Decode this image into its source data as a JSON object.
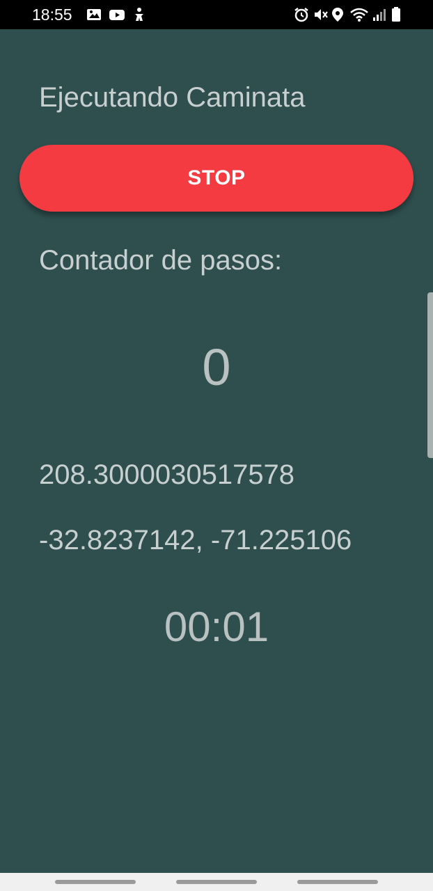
{
  "status_bar": {
    "time": "18:55",
    "left_icons": [
      "image-icon",
      "youtube-icon",
      "accessibility-icon"
    ],
    "right_icons": [
      "alarm-icon",
      "mute-icon",
      "location-icon",
      "wifi-icon",
      "signal-icon",
      "battery-icon"
    ]
  },
  "screen": {
    "title": "Ejecutando Caminata",
    "stop_button_label": "STOP",
    "counter_label": "Contador de pasos:",
    "step_count": "0",
    "altitude": "208.3000030517578",
    "coordinates": "-32.8237142, -71.225106",
    "timer": "00:01"
  },
  "colors": {
    "background": "#2f4f4f",
    "stop_button": "#f43b42",
    "text": "#c8cfcf",
    "status_bar": "#000000",
    "nav_bar": "#f0f0f0"
  }
}
